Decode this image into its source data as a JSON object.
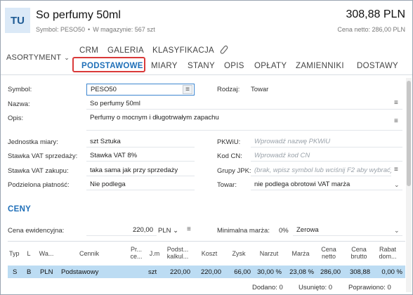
{
  "header": {
    "avatar_text": "TU",
    "title": "So perfumy 50ml",
    "symbol_label": "Symbol: PESO50",
    "separator": "•",
    "stock_label": "W magazynie: 567 szt",
    "price": "308,88 PLN",
    "net_price": "Cena netto: 286,00 PLN"
  },
  "tabs": {
    "assortment": "ASORTYMENT",
    "row1": [
      "CRM",
      "GALERIA",
      "KLASYFIKACJA"
    ],
    "row2": [
      "PODSTAWOWE",
      "MIARY",
      "STANY",
      "OPIS",
      "OPŁATY",
      "ZAMIENNIKI",
      "DOSTAWY"
    ],
    "attachment_icon": "paperclip-icon",
    "active": "PODSTAWOWE"
  },
  "form": {
    "symbol_label": "Symbol:",
    "symbol_value": "PESO50",
    "kind_label": "Rodzaj:",
    "kind_value": "Towar",
    "name_label": "Nazwa:",
    "name_value": "So perfumy 50ml",
    "desc_label": "Opis:",
    "desc_value": "Perfumy o mocnym i długotrwałym zapachu",
    "unit_label": "Jednostka miary:",
    "unit_value": "szt  Sztuka",
    "vat_sale_label": "Stawka VAT sprzedaży:",
    "vat_sale_value": "Stawka VAT 8%",
    "vat_buy_label": "Stawka VAT zakupu:",
    "vat_buy_value": "taka sama jak przy sprzedaży",
    "split_label": "Podzielona płatność:",
    "split_value": "Nie podlega",
    "pkwiu_label": "PKWiU:",
    "pkwiu_placeholder": "Wprowadź nazwę PKWiU",
    "cn_label": "Kod CN:",
    "cn_placeholder": "Wprowadź kod CN",
    "jpk_label": "Grupy JPK:",
    "jpk_placeholder": "(brak, wpisz symbol lub wciśnij F2 aby wybrać)",
    "goods_label": "Towar:",
    "goods_value": "nie podlega obrotowi VAT marża"
  },
  "prices": {
    "section_title": "CENY",
    "record_price_label": "Cena ewidencyjna:",
    "record_price_value": "220,00",
    "currency": "PLN",
    "min_margin_label": "Minimalna marża:",
    "min_margin_value": "0%",
    "min_margin_option": "Zerowa"
  },
  "table": {
    "headers": [
      "Typ",
      "L",
      "Wa...",
      "Cennik",
      "Pr... ce...",
      "J.m",
      "Podst... kalkul...",
      "Koszt",
      "Zysk",
      "Narzut",
      "Marża",
      "Cena netto",
      "Cena brutto",
      "Rabat dom..."
    ],
    "row": [
      "S",
      "B",
      "PLN",
      "Podstawowy",
      "",
      "szt",
      "220,00",
      "220,00",
      "66,00",
      "30,00 %",
      "23,08 %",
      "286,00",
      "308,88",
      "0,00 %"
    ]
  },
  "footer": {
    "added": "Dodano:  0",
    "removed": "Usunięto:  0",
    "fixed": "Poprawiono:  0"
  },
  "colors": {
    "accent": "#1f6fb8",
    "highlight_border": "#d93a3a",
    "selected_row": "#bcdcf3"
  }
}
